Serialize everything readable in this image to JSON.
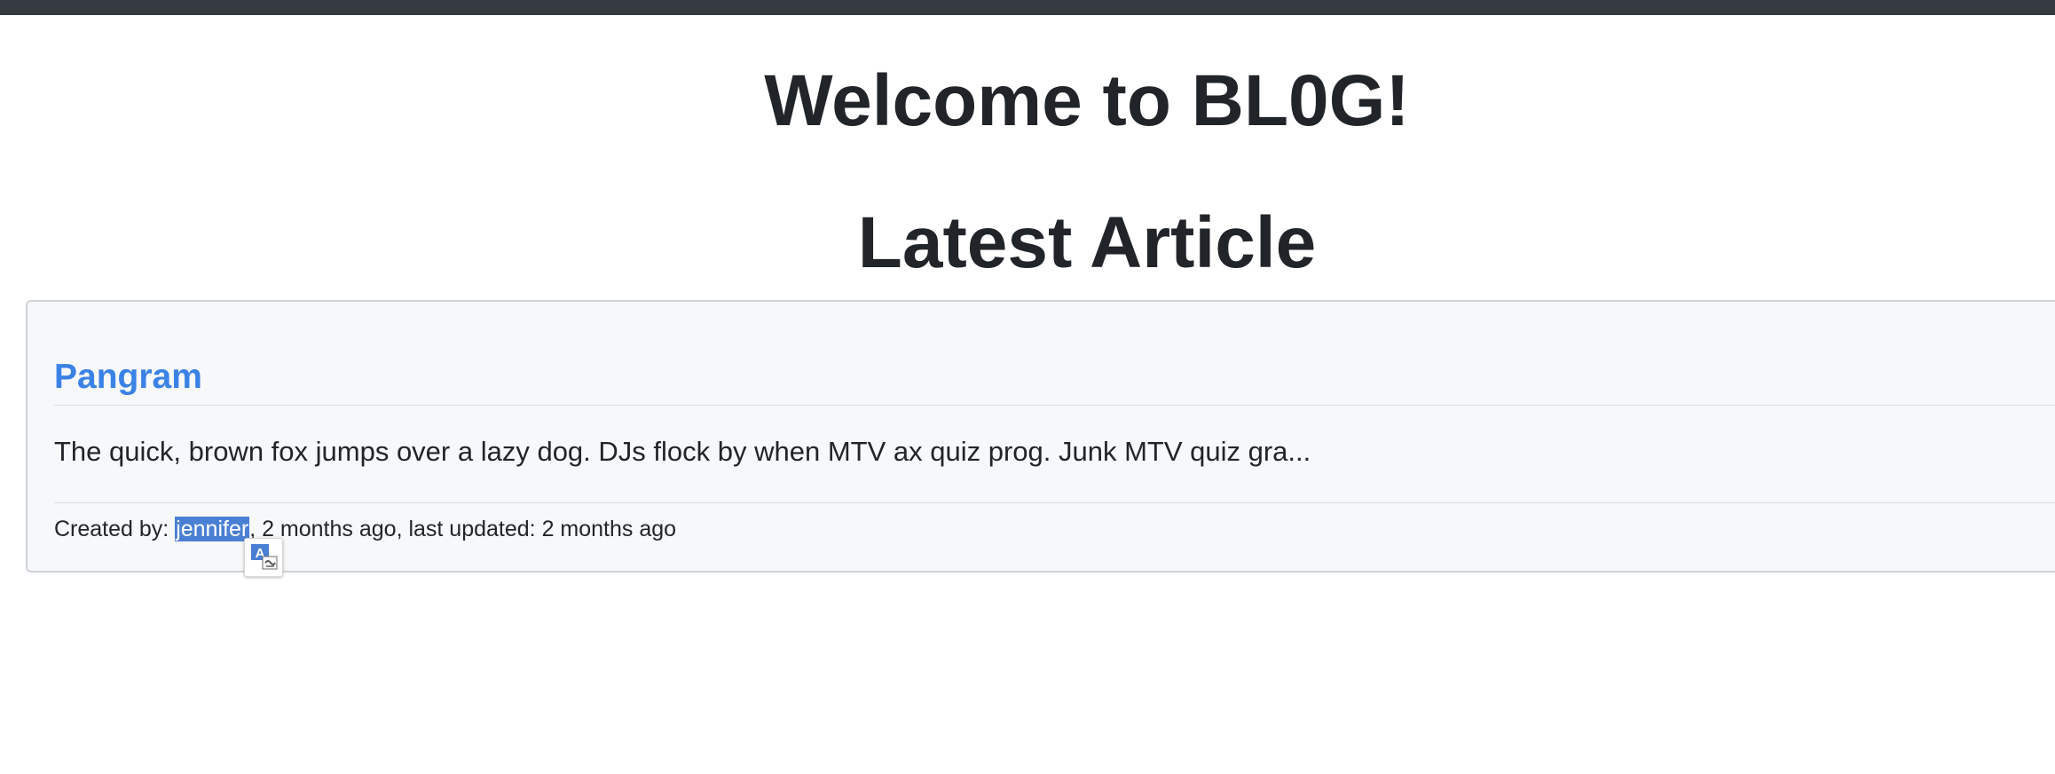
{
  "page": {
    "welcome_heading": "Welcome to BL0G!",
    "latest_heading": "Latest Article"
  },
  "article": {
    "title": "Pangram",
    "excerpt": "The quick, brown fox jumps over a lazy dog. DJs flock by when MTV ax quiz prog. Junk MTV quiz gra...",
    "meta_prefix": "Created by: ",
    "author": "jennifer",
    "meta_suffix": ", 2 months ago, last updated: 2 months ago"
  },
  "translate_popup": {
    "icon": "translate-icon"
  },
  "colors": {
    "navbar": "#343a40",
    "link": "#3b82e6",
    "selection": "#4a7fd4",
    "card_bg": "#f7f8f9"
  }
}
